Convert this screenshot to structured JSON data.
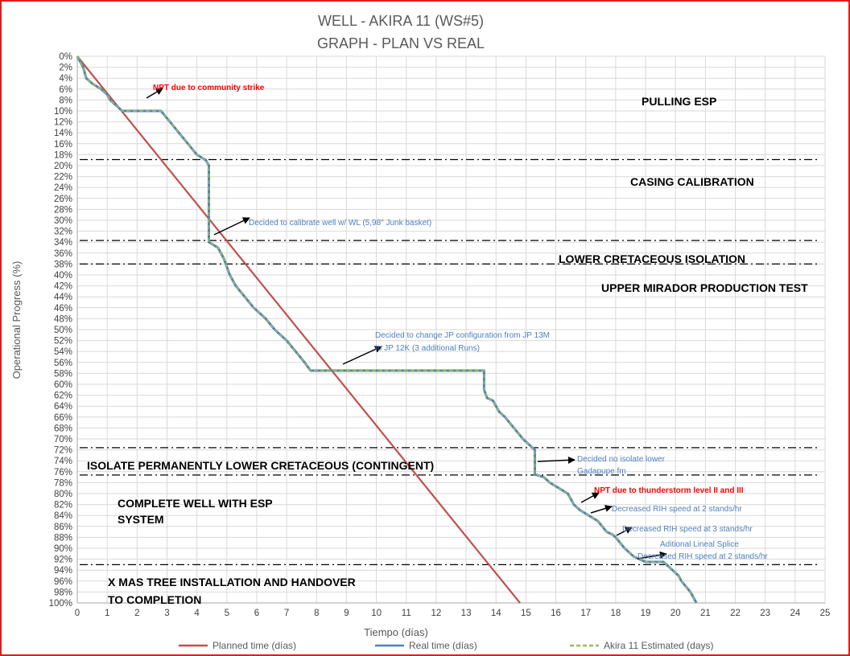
{
  "chart_data": {
    "type": "line",
    "title": "WELL -  AKIRA 11 (WS#5)",
    "subtitle": "GRAPH  - PLAN VS REAL",
    "xlabel": "Tiempo (días)",
    "ylabel": "Operational Progress (%)",
    "xlim": [
      0,
      25
    ],
    "ylim": [
      0,
      100
    ],
    "y_inverted": true,
    "grid": true,
    "x_ticks": [
      "0",
      "1",
      "2",
      "3",
      "4",
      "5",
      "6",
      "7",
      "8",
      "9",
      "10",
      "11",
      "12",
      "13",
      "14",
      "15",
      "16",
      "17",
      "18",
      "19",
      "20",
      "21",
      "22",
      "23",
      "24",
      "25"
    ],
    "y_ticks": [
      "0%",
      "2%",
      "4%",
      "6%",
      "8%",
      "10%",
      "12%",
      "14%",
      "16%",
      "18%",
      "20%",
      "22%",
      "24%",
      "26%",
      "28%",
      "30%",
      "32%",
      "34%",
      "36%",
      "38%",
      "40%",
      "42%",
      "44%",
      "46%",
      "48%",
      "50%",
      "52%",
      "54%",
      "56%",
      "58%",
      "60%",
      "62%",
      "64%",
      "66%",
      "68%",
      "70%",
      "72%",
      "74%",
      "76%",
      "78%",
      "80%",
      "82%",
      "84%",
      "86%",
      "88%",
      "90%",
      "92%",
      "94%",
      "96%",
      "98%",
      "100%"
    ],
    "legend_position": "bottom",
    "series": [
      {
        "name": "Planned time (días)",
        "color": "#c0504d",
        "style": "solid",
        "x": [
          0,
          14.8
        ],
        "y": [
          0,
          100
        ]
      },
      {
        "name": "Real time (días)",
        "color": "#4f81bd",
        "style": "solid",
        "x": [
          0,
          0.2,
          0.3,
          0.5,
          0.8,
          1.0,
          1.1,
          1.3,
          1.5,
          2.8,
          3.1,
          3.4,
          3.7,
          4.0,
          4.3,
          4.4,
          4.4,
          4.7,
          4.9,
          5.1,
          5.3,
          5.6,
          5.9,
          6.1,
          6.3,
          6.6,
          6.8,
          7.0,
          7.3,
          7.6,
          7.8,
          8.0,
          13.6,
          13.6,
          13.7,
          13.9,
          14.1,
          14.3,
          14.6,
          14.9,
          15.2,
          15.3,
          15.3,
          15.6,
          15.8,
          16.1,
          16.4,
          16.6,
          16.8,
          17.1,
          17.4,
          17.7,
          17.9,
          18.0,
          18.3,
          18.6,
          18.8,
          19.0,
          19.3,
          19.6,
          19.7,
          19.9,
          20.1,
          20.2,
          20.5,
          20.7
        ],
        "y": [
          0,
          2,
          4,
          5,
          6,
          7,
          8,
          9,
          10,
          10,
          12,
          14,
          16,
          18,
          19,
          20,
          34,
          35,
          37,
          40,
          42,
          44,
          46,
          47,
          48,
          50,
          51,
          52,
          54,
          56,
          57.5,
          57.5,
          57.5,
          61,
          62.5,
          63,
          65,
          66,
          68,
          70,
          71.5,
          72,
          76.5,
          77,
          78,
          79,
          80,
          82,
          83,
          84,
          85,
          87,
          87.5,
          88,
          90,
          91.5,
          92,
          92.5,
          92.5,
          92.5,
          93,
          94,
          95,
          96,
          98,
          100
        ]
      },
      {
        "name": "Akira 11 Estimated (days)",
        "color": "#9bbb59",
        "style": "dashed",
        "x": [
          0,
          0.2,
          0.3,
          0.5,
          0.8,
          1.0,
          1.1,
          1.3,
          1.5,
          2.8,
          3.1,
          3.4,
          3.7,
          4.0,
          4.3,
          4.4,
          4.4,
          4.7,
          4.9,
          5.1,
          5.3,
          5.6,
          5.9,
          6.1,
          6.3,
          6.6,
          6.8,
          7.0,
          7.3,
          7.6,
          7.8,
          8.0,
          13.6,
          13.6,
          13.7,
          13.9,
          14.1,
          14.3,
          14.6,
          14.9,
          15.2,
          15.3,
          15.3,
          15.6,
          15.8,
          16.1,
          16.4,
          16.6,
          16.8,
          17.1,
          17.4,
          17.7,
          17.9,
          18.0,
          18.3,
          18.6,
          18.8,
          19.0,
          19.3,
          19.6,
          19.7,
          19.9,
          20.1,
          20.2,
          20.5,
          20.7
        ],
        "y": [
          0,
          2,
          4,
          5,
          6,
          7,
          8,
          9,
          10,
          10,
          12,
          14,
          16,
          18,
          19,
          20,
          34,
          35,
          37,
          40,
          42,
          44,
          46,
          47,
          48,
          50,
          51,
          52,
          54,
          56,
          57.5,
          57.5,
          57.5,
          61,
          62.5,
          63,
          65,
          66,
          68,
          70,
          71.5,
          72,
          76.5,
          77,
          78,
          79,
          80,
          82,
          83,
          84,
          85,
          87,
          87.5,
          88,
          90,
          91.5,
          92,
          92.5,
          92.5,
          92.5,
          93,
          94,
          95,
          96,
          98,
          100
        ]
      }
    ],
    "phase_lines_y": [
      18.9,
      33.7,
      38.0,
      71.6,
      76.6,
      93.0
    ],
    "phases": [
      "PULLING ESP",
      "CASING CALIBRATION",
      "LOWER CRETACEOUS ISOLATION",
      "UPPER MIRADOR PRODUCTION TEST",
      "ISOLATE PERMANENTLY LOWER CRETACEOUS (CONTINGENT)",
      "COMPLETE WELL WITH ESP",
      "SYSTEM",
      "X MAS TREE INSTALLATION AND HANDOVER",
      "TO COMPLETION"
    ],
    "annotations": [
      "NPT due to community strike",
      "Decided to calibrate well w/ WL (5,98\" Junk basket)",
      "Decided to change JP configuration from JP 13M",
      "to JP 12K (3 additional Runs)",
      "Decided no isolate lower",
      "Gadapupe fm",
      "NPT due to thunderstorm level II and III",
      "Decreased RIH speed at 2 stands/hr",
      "Decreased RIH speed at 3 stands/hr",
      "Aditional Lineal Splice",
      "Decreased RIH speed at 2 stands/hr"
    ]
  }
}
